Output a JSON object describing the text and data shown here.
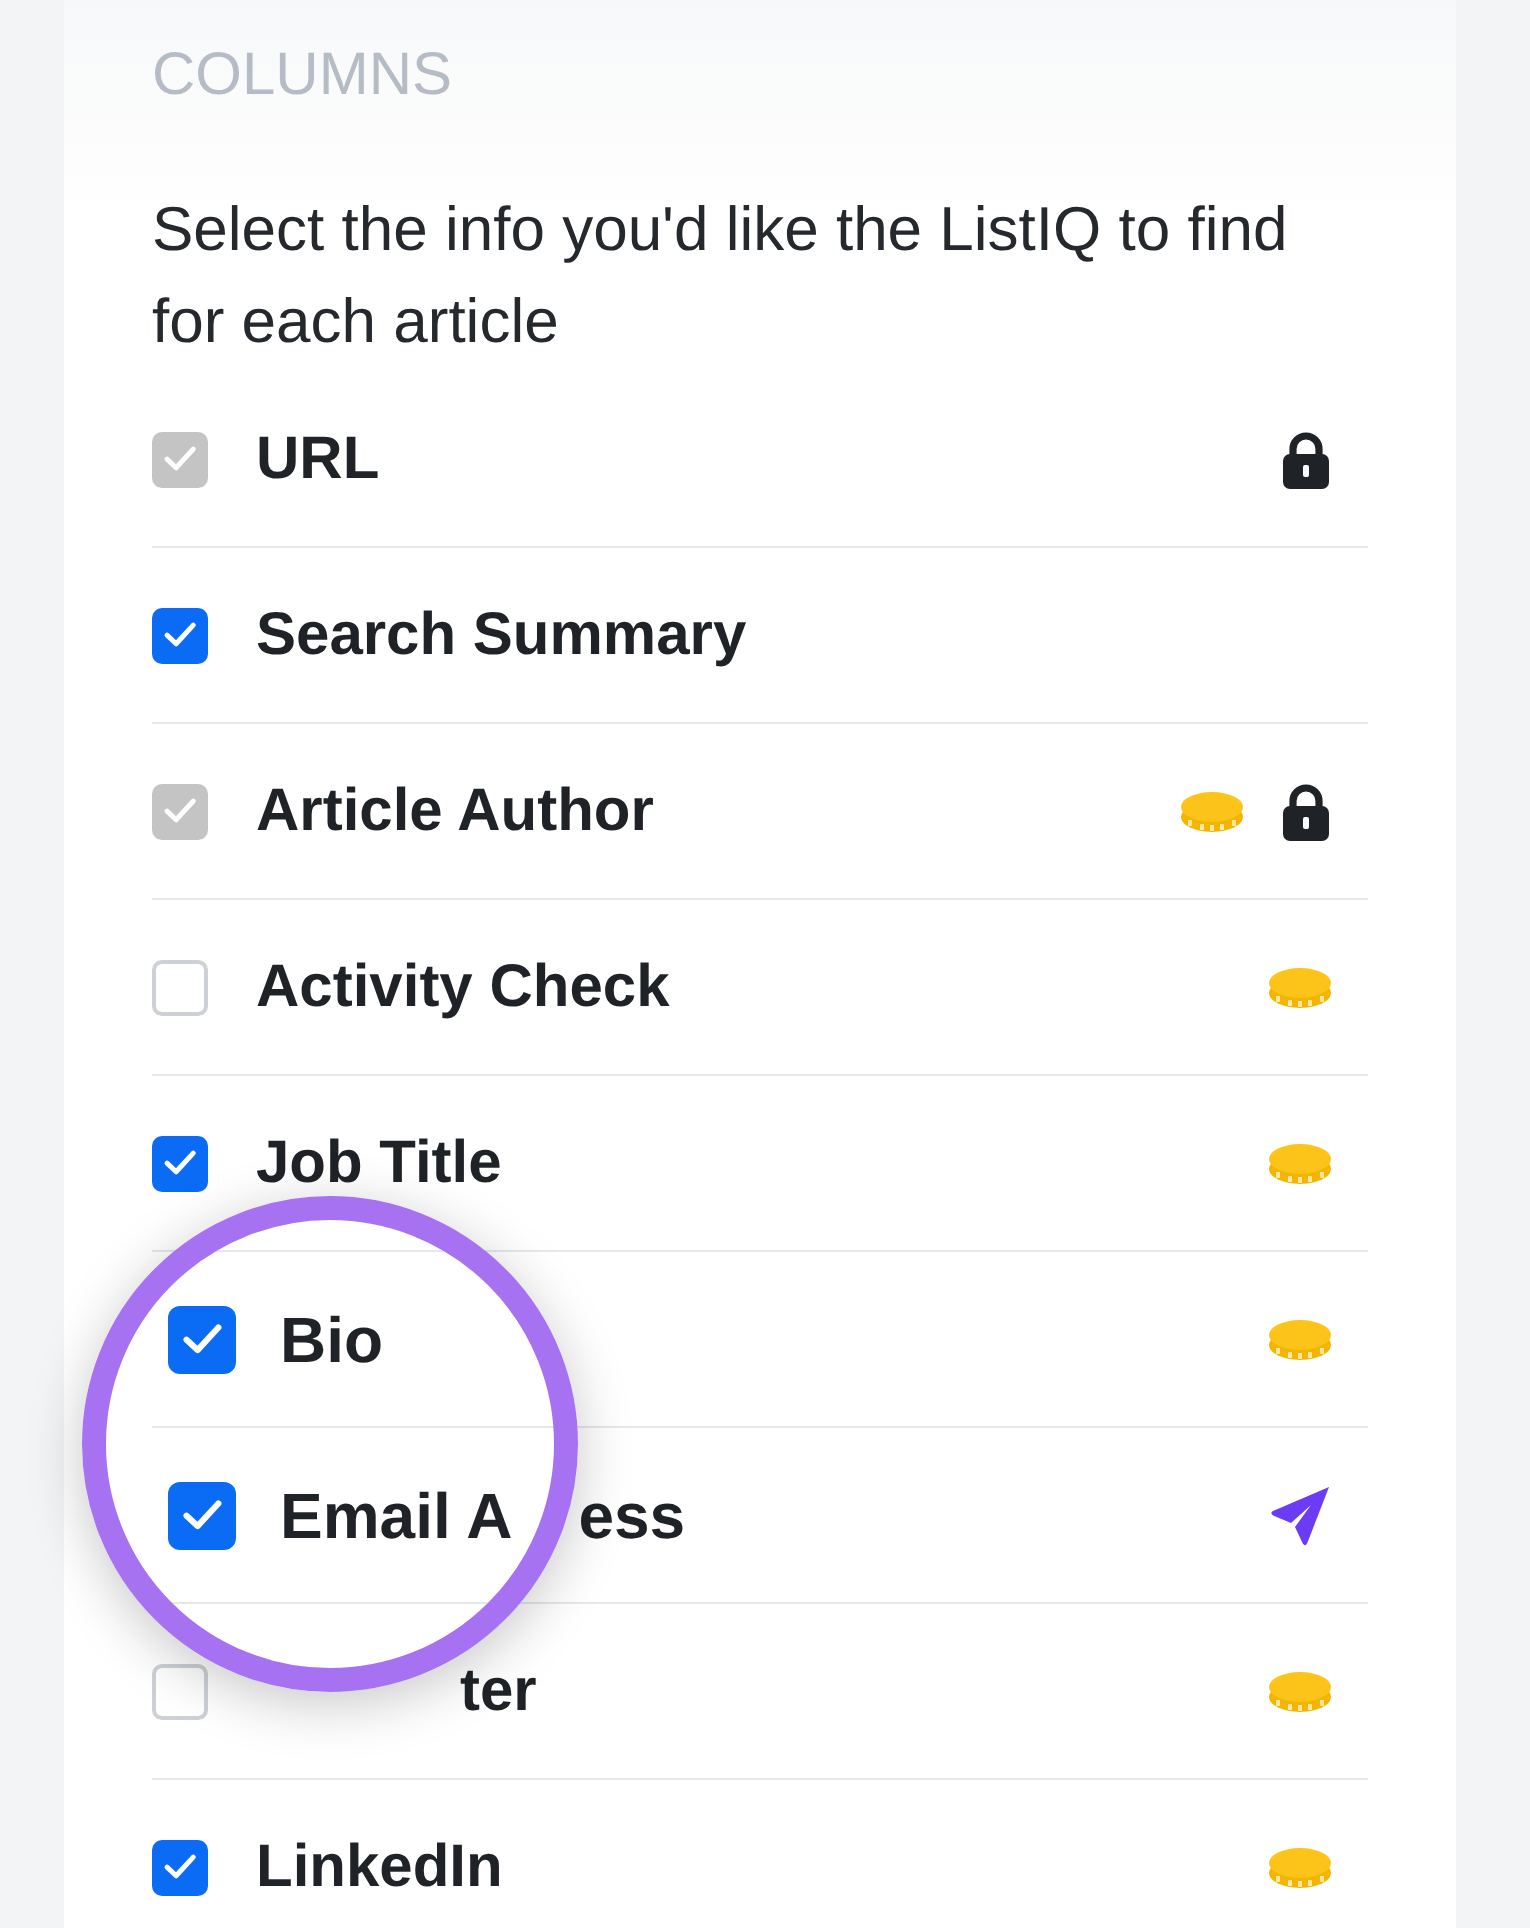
{
  "section": {
    "title": "COLUMNS",
    "description": "Select the info you'd like the ListIQ to find for each article"
  },
  "columns": [
    {
      "kind": "plain",
      "label": "URL",
      "checked": true,
      "locked": true,
      "costs_credit": false,
      "sends": false
    },
    {
      "kind": "plain",
      "label": "Search Summary",
      "checked": true,
      "locked": false,
      "costs_credit": false,
      "sends": false
    },
    {
      "kind": "plain",
      "label": "Article Author",
      "checked": true,
      "locked": true,
      "costs_credit": true,
      "sends": false
    },
    {
      "kind": "plain",
      "label": "Activity Check",
      "checked": false,
      "locked": false,
      "costs_credit": true,
      "sends": false
    },
    {
      "kind": "plain",
      "label": "Job Title",
      "checked": true,
      "locked": false,
      "costs_credit": true,
      "sends": false
    },
    {
      "kind": "magnified",
      "label": "Bio",
      "checked": true,
      "locked": false,
      "costs_credit": true,
      "sends": false
    },
    {
      "kind": "magnified",
      "label": "Email A",
      "label_tail": "ess",
      "checked": true,
      "locked": false,
      "costs_credit": false,
      "sends": true
    },
    {
      "kind": "covered",
      "label": "ter",
      "checked": false,
      "locked": false,
      "costs_credit": true,
      "sends": false
    },
    {
      "kind": "plain",
      "label": "LinkedIn",
      "checked": true,
      "locked": false,
      "costs_credit": true,
      "sends": false
    }
  ]
}
